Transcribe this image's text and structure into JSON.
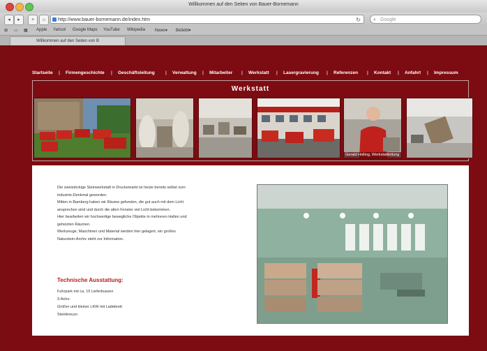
{
  "browser": {
    "window_title": "Willkommen auf den Seiten von Bauer-Bornemann",
    "url": "http://www.bauer-bornemann.de/index.htm",
    "search_placeholder": "Google",
    "bookmarks": [
      "Apple",
      "Yahoo!",
      "Google Maps",
      "YouTube",
      "Wikipedia",
      "News▾",
      "Beliebt▾"
    ],
    "tab_label": "Willkommen auf den Seiten von B"
  },
  "page": {
    "nav": [
      "Startseite",
      "Firmengeschichte",
      "Geschäftsleitung",
      "Verwaltung",
      "Mitarbeiter",
      "Werkstatt",
      "Lasergravierung",
      "Referenzen",
      "Kontakt",
      "Anfahrt",
      "Impressum"
    ],
    "section_title": "Werkstatt",
    "photo_caption": "Gerald Holling, Werkstattleitung",
    "intro": [
      "Die zweistöckige Steinwerkstatt in Druckemarkt ist heute bereits selbst zum",
      "industrie-Denkmal geworden.",
      "Mitten in Bamberg haben wir Räume gefunden, die gut auch mit dem Licht",
      "ansprechen sind und durch die alten Fenster viel Licht bekommen.",
      "Hier bearbeiten wir hochwertige bewegliche Objekte in mehreren Hallen und",
      "geheizten Räumen.",
      "Werkzeuge, Maschinen und Material werden hier gelagert, ein großes",
      "Naturstein-Archiv steht zur Information."
    ],
    "equipment_title": "Technische Ausstattung:",
    "equipment": [
      "Fuhrpark mit ca. 15 Lieferbussen",
      "3-Achs-",
      "Größer und kleiner LKW mit Ladebrett",
      "Steinkreuzo"
    ]
  },
  "colors": {
    "page_bg": "#7c0c12",
    "accent_red": "#b3201e",
    "content_bg": "#ffffff"
  }
}
